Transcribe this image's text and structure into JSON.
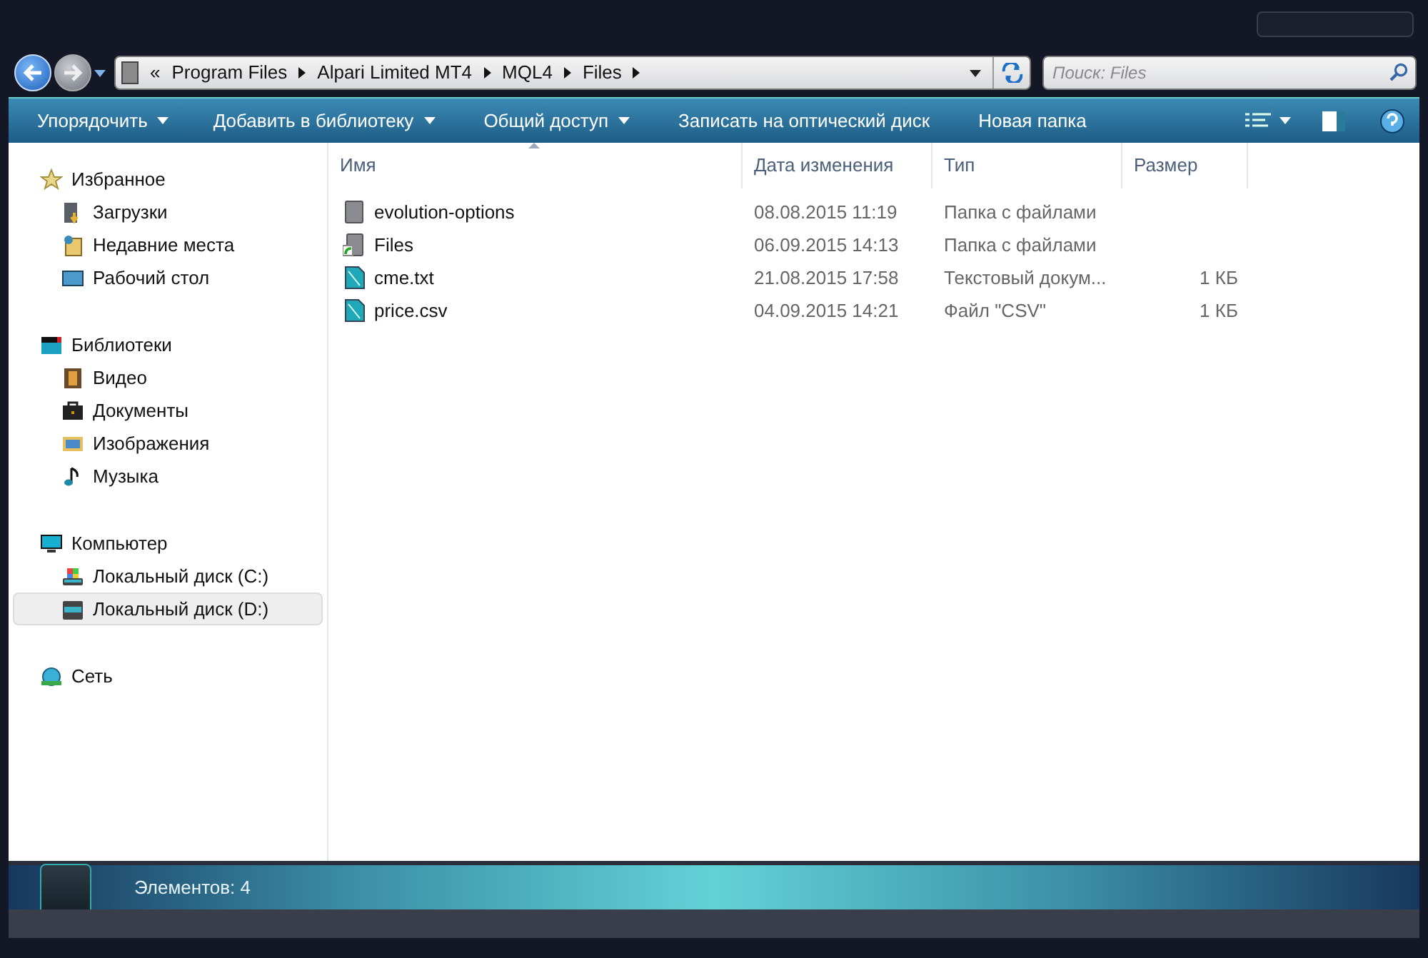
{
  "address_bar": {
    "overflow": "«",
    "path": [
      "Program Files",
      "Alpari Limited MT4",
      "MQL4",
      "Files"
    ]
  },
  "search": {
    "placeholder": "Поиск: Files"
  },
  "toolbar": [
    {
      "label": "Упорядочить",
      "has_menu": true
    },
    {
      "label": "Добавить в библиотеку",
      "has_menu": true
    },
    {
      "label": "Общий доступ",
      "has_menu": true
    },
    {
      "label": "Записать на оптический диск",
      "has_menu": false
    },
    {
      "label": "Новая папка",
      "has_menu": false
    }
  ],
  "sidebar": [
    {
      "label": "Избранное",
      "kind": "star",
      "children": [
        {
          "label": "Загрузки",
          "kind": "downloads",
          "selected": false
        },
        {
          "label": "Недавние места",
          "kind": "recent",
          "selected": false
        },
        {
          "label": "Рабочий стол",
          "kind": "desktop",
          "selected": false
        }
      ]
    },
    {
      "label": "Библиотеки",
      "kind": "library",
      "children": [
        {
          "label": "Видео",
          "kind": "video",
          "selected": false
        },
        {
          "label": "Документы",
          "kind": "documents",
          "selected": false
        },
        {
          "label": "Изображения",
          "kind": "pictures",
          "selected": false
        },
        {
          "label": "Музыка",
          "kind": "music",
          "selected": false
        }
      ]
    },
    {
      "label": "Компьютер",
      "kind": "computer",
      "children": [
        {
          "label": "Локальный диск (C:)",
          "kind": "system-drive",
          "selected": false
        },
        {
          "label": "Локальный диск (D:)",
          "kind": "drive",
          "selected": true
        }
      ]
    },
    {
      "label": "Сеть",
      "kind": "network"
    }
  ],
  "table": {
    "columns": [
      "Имя",
      "Дата изменения",
      "Тип",
      "Размер"
    ],
    "rows": [
      {
        "kind": "folder",
        "name": "evolution-options",
        "date": "08.08.2015 11:19",
        "type": "Папка с файлами"
      },
      {
        "kind": "folder-shortcut",
        "name": "Files",
        "date": "06.09.2015 14:13",
        "type": "Папка с файлами"
      },
      {
        "kind": "file",
        "name": "cme.txt",
        "date": "21.08.2015 17:58",
        "type": "Текстовый докум...",
        "size": "1 КБ"
      },
      {
        "kind": "file",
        "name": "price.csv",
        "date": "04.09.2015 14:21",
        "type": "Файл \"CSV\"",
        "size": "1 КБ"
      }
    ]
  },
  "status_bar": {
    "text": "Элементов: 4"
  }
}
